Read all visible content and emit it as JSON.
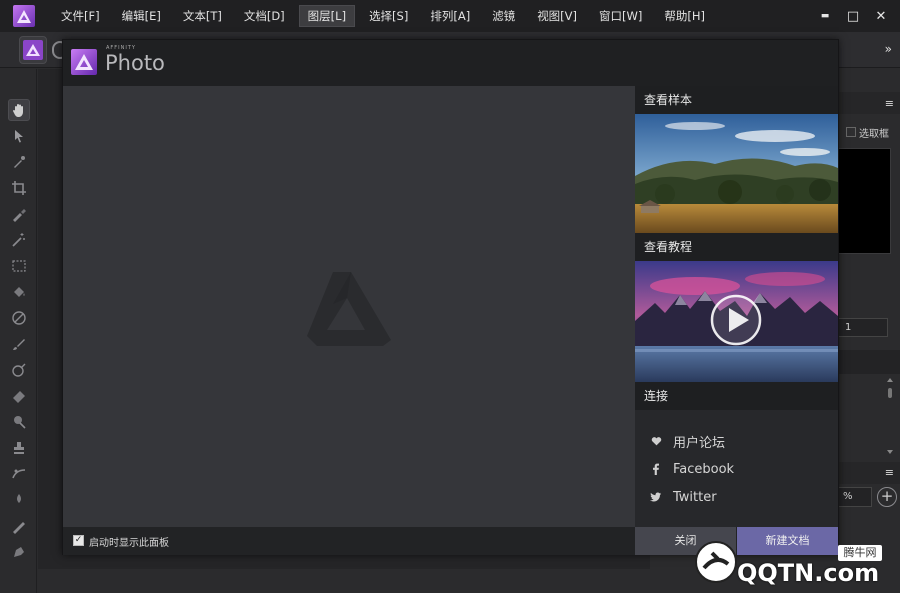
{
  "menubar": {
    "items": [
      "文件[F]",
      "编辑[E]",
      "文本[T]",
      "文档[D]",
      "图层[L]",
      "选择[S]",
      "排列[A]",
      "滤镜",
      "视图[V]",
      "窗口[W]",
      "帮助[H]"
    ],
    "active_index": 4,
    "minimize": "▬",
    "maximize": "□",
    "close": "✕"
  },
  "context_toolbar": {
    "overflow": "»"
  },
  "right_panel": {
    "menu1": "≡",
    "checkbox_label": "选取框",
    "field_value": "1",
    "menu2": "≡",
    "percent_value": "%",
    "add": "+"
  },
  "dialog": {
    "brand_small": "AFFINITY",
    "title": "Photo",
    "side": {
      "samples_heading": "查看样本",
      "tutorials_heading": "查看教程",
      "connect_heading": "连接",
      "connect_items": [
        {
          "label": "用户论坛",
          "icon": "heart-icon"
        },
        {
          "label": "Facebook",
          "icon": "facebook-icon"
        },
        {
          "label": "Twitter",
          "icon": "twitter-icon"
        }
      ]
    },
    "footer": {
      "startup_checkbox_checked": true,
      "startup_label": "启动时显示此面板",
      "close_button": "关闭",
      "new_doc_button": "新建文档"
    }
  },
  "site_watermark": {
    "brand": "QQTN.com",
    "cn": "腾牛网"
  },
  "colors": {
    "accent": "#6b68a6",
    "affinity_purple": "#a65ad8"
  }
}
